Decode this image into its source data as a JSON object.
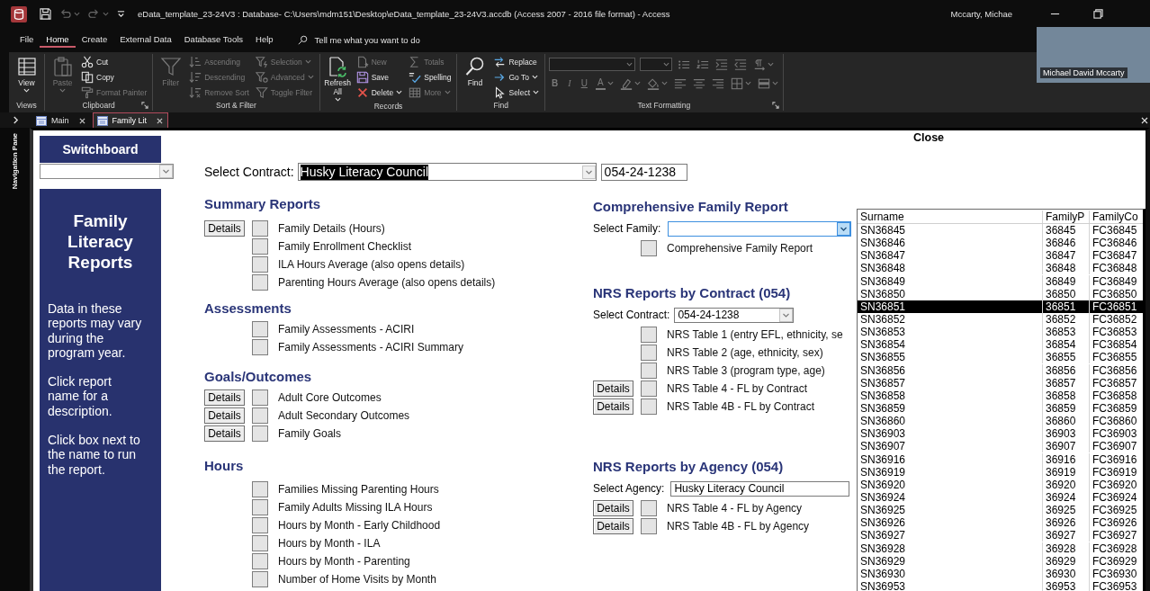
{
  "window": {
    "title": "eData_template_23-24V3 : Database- C:\\Users\\mdm151\\Desktop\\eData_template_23-24V3.accdb (Access 2007 - 2016 file format) - Access",
    "user": "Mccarty, Michae"
  },
  "quick_access": [
    {
      "kind": "save",
      "disabled": false
    },
    {
      "kind": "undo",
      "disabled": true,
      "dropdown": true
    },
    {
      "kind": "redo",
      "disabled": true,
      "dropdown": true
    },
    {
      "kind": "customize",
      "disabled": false
    }
  ],
  "menu": [
    {
      "label": "File",
      "selected": false
    },
    {
      "label": "Home",
      "selected": true
    },
    {
      "label": "Create",
      "selected": false
    },
    {
      "label": "External Data",
      "selected": false
    },
    {
      "label": "Database Tools",
      "selected": false
    },
    {
      "label": "Help",
      "selected": false
    }
  ],
  "tell_me": {
    "placeholder": "Tell me what you want to do"
  },
  "ribbon": {
    "groups": [
      {
        "label": "Views",
        "kind": "commands",
        "launcher": false,
        "columns": [
          [
            {
              "label": "View",
              "kind": "large",
              "disabled": false,
              "dropdown": true
            }
          ]
        ]
      },
      {
        "label": "Clipboard",
        "kind": "commands",
        "launcher": true,
        "columns": [
          [
            {
              "label": "Paste",
              "kind": "large",
              "disabled": true,
              "dropdown": true
            }
          ],
          [
            {
              "label": "Cut",
              "kind": "small",
              "disabled": false
            },
            {
              "label": "Copy",
              "kind": "small",
              "disabled": false
            },
            {
              "label": "Format Painter",
              "kind": "small",
              "disabled": true
            }
          ]
        ]
      },
      {
        "label": "Sort & Filter",
        "kind": "commands",
        "launcher": false,
        "columns": [
          [
            {
              "label": "Filter",
              "kind": "large",
              "disabled": true
            }
          ],
          [
            {
              "label": "Ascending",
              "kind": "small",
              "disabled": true
            },
            {
              "label": "Descending",
              "kind": "small",
              "disabled": true
            },
            {
              "label": "Remove Sort",
              "kind": "small",
              "disabled": true
            }
          ],
          [
            {
              "label": "Selection",
              "kind": "small",
              "disabled": true,
              "dropdown": true
            },
            {
              "label": "Advanced",
              "kind": "small",
              "disabled": true,
              "dropdown": true
            },
            {
              "label": "Toggle Filter",
              "kind": "small",
              "disabled": true
            }
          ]
        ]
      },
      {
        "label": "Records",
        "kind": "commands",
        "launcher": false,
        "columns": [
          [
            {
              "label": "Refresh All",
              "kind": "large",
              "disabled": false,
              "dropdown": true
            }
          ],
          [
            {
              "label": "New",
              "kind": "small",
              "disabled": true
            },
            {
              "label": "Save",
              "kind": "small",
              "disabled": false
            },
            {
              "label": "Delete",
              "kind": "small",
              "disabled": false,
              "dropdown": true
            }
          ],
          [
            {
              "label": "Totals",
              "kind": "small",
              "disabled": true
            },
            {
              "label": "Spelling",
              "kind": "small",
              "disabled": false
            },
            {
              "label": "More",
              "kind": "small",
              "disabled": true,
              "dropdown": true
            }
          ]
        ]
      },
      {
        "label": "Find",
        "kind": "commands",
        "launcher": false,
        "columns": [
          [
            {
              "label": "Find",
              "kind": "large",
              "disabled": false
            }
          ],
          [
            {
              "label": "Replace",
              "kind": "small",
              "disabled": false
            },
            {
              "label": "Go To",
              "kind": "small",
              "disabled": false,
              "dropdown": true
            },
            {
              "label": "Select",
              "kind": "small",
              "disabled": false,
              "dropdown": true
            }
          ]
        ]
      },
      {
        "label": "Text Formatting",
        "kind": "formatting",
        "launcher": true,
        "rows": [
          [
            {
              "kind": "combo",
              "disabled": true
            },
            {
              "kind": "combo",
              "disabled": true
            },
            {
              "kind": "icon",
              "disabled": true
            },
            {
              "kind": "icon",
              "disabled": true
            },
            {
              "kind": "icon",
              "disabled": true
            },
            {
              "kind": "icon",
              "disabled": true
            },
            {
              "kind": "icon",
              "disabled": true,
              "dropdown": true
            }
          ],
          [
            {
              "kind": "glyph",
              "label": "B",
              "disabled": true
            },
            {
              "kind": "glyph",
              "label": "I",
              "disabled": true
            },
            {
              "kind": "glyph",
              "label": "U",
              "disabled": true
            },
            {
              "kind": "glyph",
              "label": "A",
              "disabled": true,
              "dropdown": true
            },
            {
              "kind": "icon",
              "disabled": true,
              "dropdown": true
            },
            {
              "kind": "icon",
              "disabled": true,
              "dropdown": true
            },
            {
              "kind": "icon",
              "disabled": true
            },
            {
              "kind": "icon",
              "disabled": true
            },
            {
              "kind": "icon",
              "disabled": true
            },
            {
              "kind": "icon",
              "disabled": true,
              "dropdown": true
            },
            {
              "kind": "icon",
              "disabled": true,
              "dropdown": true
            }
          ]
        ]
      }
    ]
  },
  "document_tabs": [
    {
      "label": "Main",
      "selected": false
    },
    {
      "label": "Family Lit",
      "selected": true
    }
  ],
  "navigation_pane": {
    "label": "Navigation Pane"
  },
  "form": {
    "close": "Close",
    "switchboard": {
      "title": "Switchboard"
    },
    "info_panel": {
      "title": "Family Literacy Reports",
      "paragraphs": [
        "Data in these reports may vary during the program year.",
        "Click report name for a description.",
        "Click box next to the name to run the report."
      ]
    },
    "contract": {
      "label": "Select Contract:",
      "value": "Husky Literacy Council",
      "value_highlighted": true,
      "code": "054-24-1238"
    },
    "left_sections": [
      {
        "heading": "Summary Reports",
        "reports": [
          {
            "label": "Family Details (Hours)",
            "details": "Details",
            "checked": false
          },
          {
            "label": "Family Enrollment Checklist",
            "checked": false
          },
          {
            "label": "ILA Hours Average (also opens details)",
            "checked": false
          },
          {
            "label": "Parenting Hours Average (also opens details)",
            "checked": false
          }
        ]
      },
      {
        "heading": "Assessments",
        "reports": [
          {
            "label": "Family Assessments - ACIRI",
            "checked": false
          },
          {
            "label": "Family Assessments - ACIRI Summary",
            "checked": false
          }
        ]
      },
      {
        "heading": "Goals/Outcomes",
        "reports": [
          {
            "label": "Adult Core Outcomes",
            "details": "Details",
            "checked": false
          },
          {
            "label": "Adult Secondary Outcomes",
            "details": "Details",
            "checked": false
          },
          {
            "label": "Family Goals",
            "details": "Details",
            "checked": false
          }
        ]
      },
      {
        "heading": "Hours",
        "reports": [
          {
            "label": "Families Missing Parenting Hours",
            "checked": false
          },
          {
            "label": "Family Adults Missing ILA Hours",
            "checked": false
          },
          {
            "label": "Hours by Month - Early Childhood",
            "checked": false
          },
          {
            "label": "Hours by Month - ILA",
            "checked": false
          },
          {
            "label": "Hours by Month - Parenting",
            "checked": false
          },
          {
            "label": "Number of Home Visits by Month",
            "checked": false
          }
        ]
      }
    ],
    "right_sections": [
      {
        "heading": "Comprehensive Family Report",
        "selector": {
          "kind": "combo",
          "label": "Select Family:",
          "open": true
        },
        "reports": [
          {
            "label": "Comprehensive Family Report",
            "checked": false
          }
        ]
      },
      {
        "heading": "NRS Reports by Contract (054)",
        "selector": {
          "kind": "combo",
          "label": "Select Contract:",
          "value": "054-24-1238",
          "open": false
        },
        "reports": [
          {
            "label": "NRS Table 1 (entry EFL, ethnicity, se",
            "checked": false
          },
          {
            "label": "NRS Table 2 (age, ethnicity, sex)",
            "checked": false
          },
          {
            "label": "NRS Table 3 (program type, age)",
            "checked": false
          },
          {
            "label": "NRS Table 4 - FL by Contract",
            "details": "Details",
            "checked": false
          },
          {
            "label": "NRS Table 4B - FL by Contract",
            "details": "Details",
            "checked": false
          }
        ]
      },
      {
        "heading": "NRS Reports by Agency (054)",
        "selector": {
          "kind": "text",
          "label": "Select Agency:",
          "value": "Husky Literacy Council"
        },
        "reports": [
          {
            "label": "NRS Table 4 - FL by Agency",
            "details": "Details",
            "checked": false
          },
          {
            "label": "NRS Table 4B - FL by Agency",
            "details": "Details",
            "checked": false
          }
        ]
      }
    ]
  },
  "family_list": {
    "columns": [
      "Surname",
      "FamilyP",
      "FamilyCo"
    ],
    "rows": [
      {
        "cells": [
          "SN36845",
          "36845",
          "FC36845"
        ],
        "selected": false
      },
      {
        "cells": [
          "SN36846",
          "36846",
          "FC36846"
        ],
        "selected": false
      },
      {
        "cells": [
          "SN36847",
          "36847",
          "FC36847"
        ],
        "selected": false
      },
      {
        "cells": [
          "SN36848",
          "36848",
          "FC36848"
        ],
        "selected": false
      },
      {
        "cells": [
          "SN36849",
          "36849",
          "FC36849"
        ],
        "selected": false
      },
      {
        "cells": [
          "SN36850",
          "36850",
          "FC36850"
        ],
        "selected": false
      },
      {
        "cells": [
          "SN36851",
          "36851",
          "FC36851"
        ],
        "selected": true
      },
      {
        "cells": [
          "SN36852",
          "36852",
          "FC36852"
        ],
        "selected": false
      },
      {
        "cells": [
          "SN36853",
          "36853",
          "FC36853"
        ],
        "selected": false
      },
      {
        "cells": [
          "SN36854",
          "36854",
          "FC36854"
        ],
        "selected": false
      },
      {
        "cells": [
          "SN36855",
          "36855",
          "FC36855"
        ],
        "selected": false
      },
      {
        "cells": [
          "SN36856",
          "36856",
          "FC36856"
        ],
        "selected": false
      },
      {
        "cells": [
          "SN36857",
          "36857",
          "FC36857"
        ],
        "selected": false
      },
      {
        "cells": [
          "SN36858",
          "36858",
          "FC36858"
        ],
        "selected": false
      },
      {
        "cells": [
          "SN36859",
          "36859",
          "FC36859"
        ],
        "selected": false
      },
      {
        "cells": [
          "SN36860",
          "36860",
          "FC36860"
        ],
        "selected": false
      },
      {
        "cells": [
          "SN36903",
          "36903",
          "FC36903"
        ],
        "selected": false
      },
      {
        "cells": [
          "SN36907",
          "36907",
          "FC36907"
        ],
        "selected": false
      },
      {
        "cells": [
          "SN36916",
          "36916",
          "FC36916"
        ],
        "selected": false
      },
      {
        "cells": [
          "SN36919",
          "36919",
          "FC36919"
        ],
        "selected": false
      },
      {
        "cells": [
          "SN36920",
          "36920",
          "FC36920"
        ],
        "selected": false
      },
      {
        "cells": [
          "SN36924",
          "36924",
          "FC36924"
        ],
        "selected": false
      },
      {
        "cells": [
          "SN36925",
          "36925",
          "FC36925"
        ],
        "selected": false
      },
      {
        "cells": [
          "SN36926",
          "36926",
          "FC36926"
        ],
        "selected": false
      },
      {
        "cells": [
          "SN36927",
          "36927",
          "FC36927"
        ],
        "selected": false
      },
      {
        "cells": [
          "SN36928",
          "36928",
          "FC36928"
        ],
        "selected": false
      },
      {
        "cells": [
          "SN36929",
          "36929",
          "FC36929"
        ],
        "selected": false
      },
      {
        "cells": [
          "SN36930",
          "36930",
          "FC36930"
        ],
        "selected": false
      },
      {
        "cells": [
          "SN36953",
          "36953",
          "FC36953"
        ],
        "selected": false
      }
    ]
  },
  "video_tile": {
    "name": "Michael David Mccarty"
  }
}
